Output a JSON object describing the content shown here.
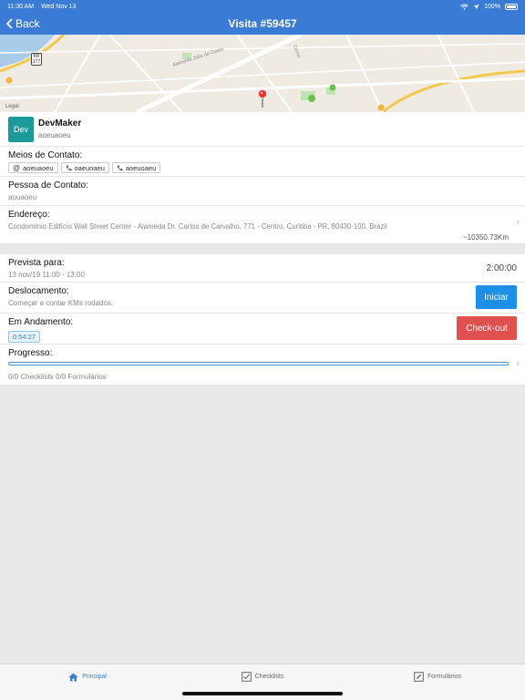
{
  "status_bar": {
    "time": "11:30 AM",
    "date": "Wed Nov 13",
    "battery": "100%"
  },
  "nav": {
    "back_label": "Back",
    "title": "Visita #59457"
  },
  "map": {
    "street_label": "Alameda Júlia da Costa",
    "street2": "Carlos",
    "route": "BR 277",
    "legal": "Legal"
  },
  "company": {
    "avatar_text": "Dev",
    "name": "DevMaker",
    "subtitle": "aoeuaoeu"
  },
  "contact": {
    "label": "Meios de Contato:",
    "chips": [
      {
        "icon": "at-icon",
        "text": "aoeuaoeu"
      },
      {
        "icon": "phone-icon",
        "text": "oaeuoaeu"
      },
      {
        "icon": "phone-icon",
        "text": "aoeuoaeu"
      }
    ]
  },
  "person": {
    "label": "Pessoa de Contato:",
    "value": "aouaoeu"
  },
  "address": {
    "label": "Endereço:",
    "value": "Condomínio Edifício Wall Street Center - Alameda Dr. Carlos de Carvalho, 771 - Centro, Curitiba - PR, 80430-100, Brazil",
    "distance": "~10350.73Km"
  },
  "prevista": {
    "label": "Prevista para:",
    "value": "13 nov/19 11:00 - 13:00",
    "duration": "2:00:00"
  },
  "deslocamento": {
    "label": "Deslocamento:",
    "value": "Começar a contar KMs rodados.",
    "button_label": "Iniciar"
  },
  "andamento": {
    "label": "Em Andamento:",
    "timer": "0:54:27",
    "button_label": "Check-out"
  },
  "progress": {
    "label": "Progresso:",
    "percent": 0,
    "summary": "0/0 Checklists 0/0 Formulários"
  },
  "tabs": [
    {
      "label": "Principal",
      "icon": "home-icon",
      "active": true
    },
    {
      "label": "Checklists",
      "icon": "checkbox-icon",
      "active": false
    },
    {
      "label": "Formulários",
      "icon": "form-icon",
      "active": false
    }
  ],
  "colors": {
    "primary": "#3a7bd5",
    "start": "#1e8fe6",
    "checkout": "#e0504f",
    "avatar": "#1c9a9a"
  }
}
